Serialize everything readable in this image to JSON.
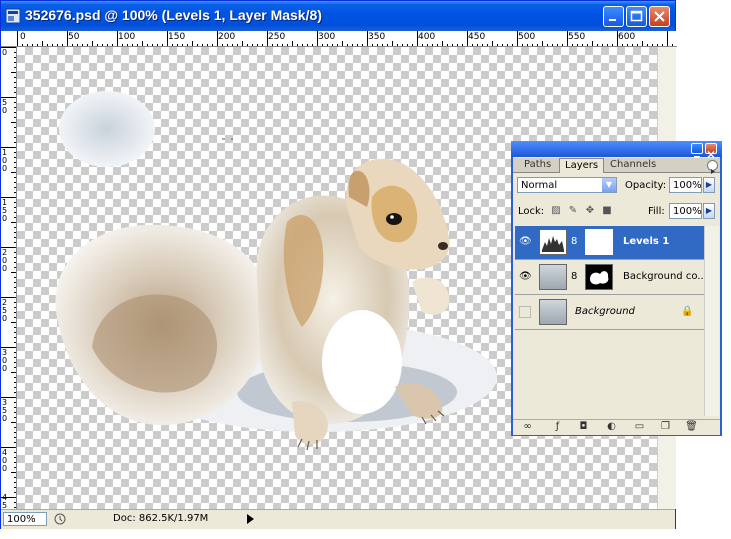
{
  "window": {
    "title": "352676.psd @ 100% (Levels 1, Layer Mask/8)",
    "app_icon": "photoshop-document-icon"
  },
  "ruler_h": [
    "0",
    "50",
    "100",
    "150",
    "200",
    "250",
    "300",
    "350",
    "400",
    "450",
    "500",
    "550",
    "600"
  ],
  "ruler_v": [
    "0",
    "50",
    "100",
    "150",
    "200",
    "250",
    "300",
    "350",
    "400",
    "450"
  ],
  "status": {
    "zoom": "100%",
    "doc": "Doc: 862.5K/1.97M"
  },
  "layers_panel": {
    "tabs": [
      "Paths",
      "Layers",
      "Channels"
    ],
    "active_tab": "Layers",
    "blend_mode": "Normal",
    "opacity_label": "Opacity:",
    "opacity_value": "100%",
    "lock_label": "Lock:",
    "fill_label": "Fill:",
    "fill_value": "100%",
    "layers": [
      {
        "name": "Levels 1",
        "selected": true,
        "visible": true
      },
      {
        "name": "Background co...",
        "selected": false,
        "visible": true
      },
      {
        "name": "Background",
        "selected": false,
        "visible": false,
        "locked": true
      }
    ]
  },
  "colors": {
    "title_bar": "#0053e1",
    "selection": "#316ac5",
    "panel_bg": "#ece9d8"
  }
}
